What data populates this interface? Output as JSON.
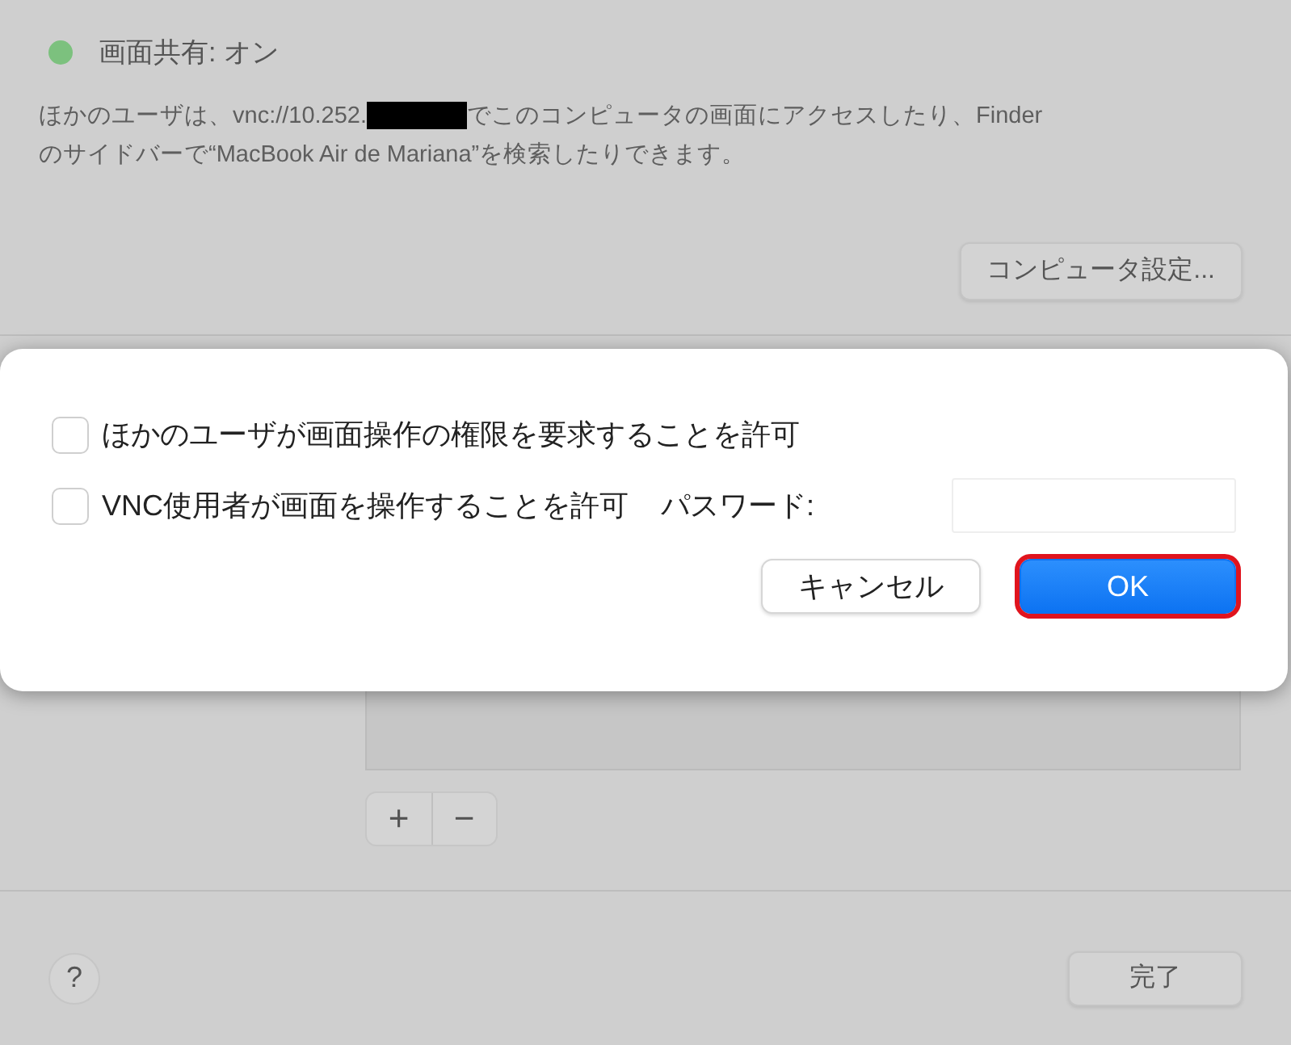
{
  "status": {
    "label": "画面共有: オン",
    "on": true
  },
  "description": {
    "before": "ほかのユーザは、vnc://10.252.",
    "after": "でこのコンピュータの画面にアクセスしたり、Finder",
    "line_2": "のサイドバーで“MacBook Air de Mariana”を検索したりできます。"
  },
  "computer_settings_button": "コンピュータ設定...",
  "list_buttons": [
    "+",
    "−"
  ],
  "help_button": "?",
  "done_button": "完了",
  "dialog": {
    "options": [
      {
        "kind": "checkbox",
        "label": "ほかのユーザが画面操作の権限を要求することを許可",
        "checked": false
      },
      {
        "kind": "checkbox",
        "label": "VNC使用者が画面を操作することを許可",
        "checked": false,
        "field_label": "パスワード:"
      }
    ],
    "buttons": [
      {
        "label": "キャンセル",
        "default": false,
        "highlighted": false
      },
      {
        "label": "OK",
        "default": true,
        "highlighted": true
      }
    ]
  }
}
